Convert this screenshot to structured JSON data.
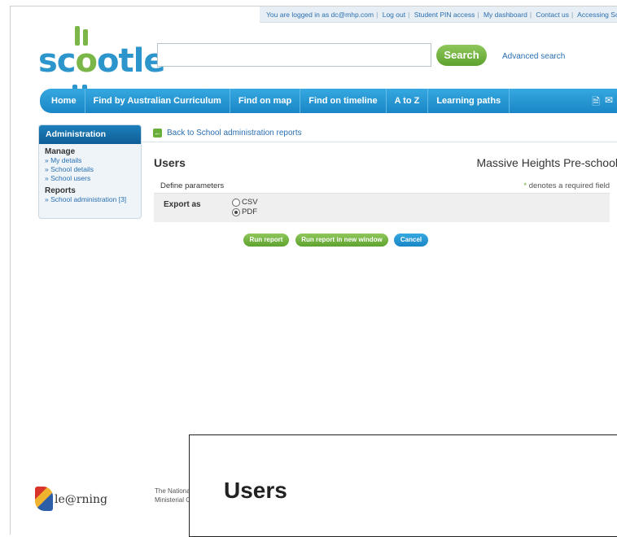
{
  "topbar": {
    "logged_in": "You are logged in as dc@mhp.com",
    "links": [
      "Log out",
      "Student PIN access",
      "My dashboard",
      "Contact us",
      "Accessing Scootle"
    ]
  },
  "logo": {
    "text_sc": "sc",
    "text_o": "o",
    "text_tle": "otle"
  },
  "search": {
    "value": "",
    "button": "Search",
    "advanced": "Advanced search"
  },
  "nav": {
    "items": [
      "Home",
      "Find by Australian Curriculum",
      "Find on map",
      "Find on timeline",
      "A to Z",
      "Learning paths"
    ],
    "icons": [
      "document-icon",
      "email-icon"
    ]
  },
  "sidebar": {
    "title": "Administration",
    "manage_heading": "Manage",
    "manage_links": [
      "» My details",
      "» School details",
      "» School users"
    ],
    "reports_heading": "Reports",
    "reports_links": [
      "» School administration [3]"
    ]
  },
  "main": {
    "back_link": "Back to School administration reports",
    "title": "Users",
    "school": "Massive Heights Pre-school",
    "define_parameters": "Define parameters",
    "required_star": "*",
    "required_note": " denotes a required field",
    "export_label": "Export as",
    "export_options": [
      {
        "label": "CSV",
        "checked": false
      },
      {
        "label": "PDF",
        "checked": true
      }
    ]
  },
  "buttons": {
    "run_report": "Run report",
    "run_new_window": "Run report in new window",
    "cancel": "Cancel"
  },
  "footer": {
    "logo_text": "le@rning",
    "text_line1": "The National",
    "text_line2": "Ministerial Coun"
  },
  "zoom": {
    "title": "Users"
  },
  "colors": {
    "primary_blue": "#1a86c6",
    "accent_green": "#6aae3a",
    "link_blue": "#2a6fb1"
  }
}
